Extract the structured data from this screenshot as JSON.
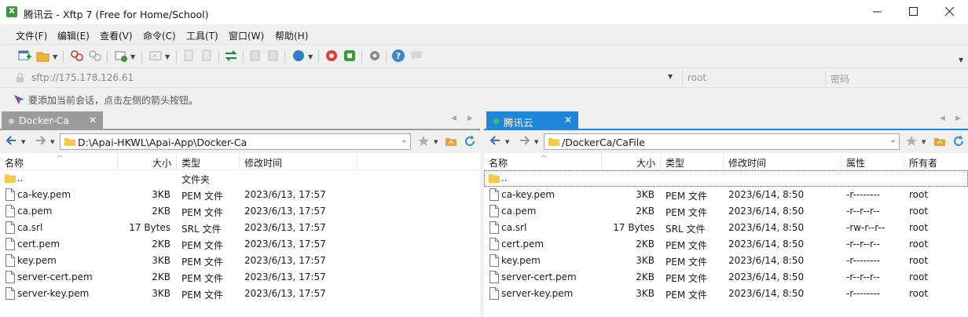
{
  "window": {
    "title": "腾讯云 - Xftp 7 (Free for Home/School)",
    "controls": [
      "minimize",
      "maximize",
      "close"
    ]
  },
  "menu": [
    "文件(F)",
    "编辑(E)",
    "查看(V)",
    "命令(C)",
    "工具(T)",
    "窗口(W)",
    "帮助(H)"
  ],
  "address": {
    "url": "sftp://175.178.126.61",
    "user_placeholder": "root",
    "password_placeholder": "密码"
  },
  "hint": "要添加当前会话，点击左侧的箭头按钮。",
  "left": {
    "tab": "Docker-Ca",
    "path": "D:\\Apai-HKWL\\Apai-App\\Docker-Ca",
    "columns": [
      "名称",
      "大小",
      "类型",
      "修改时间"
    ],
    "rows": [
      {
        "name": "..",
        "size": "",
        "type": "文件夹",
        "modified": "",
        "folder": true
      },
      {
        "name": "ca-key.pem",
        "size": "3KB",
        "type": "PEM 文件",
        "modified": "2023/6/13, 17:57"
      },
      {
        "name": "ca.pem",
        "size": "2KB",
        "type": "PEM 文件",
        "modified": "2023/6/13, 17:57"
      },
      {
        "name": "ca.srl",
        "size": "17 Bytes",
        "type": "SRL 文件",
        "modified": "2023/6/13, 17:57"
      },
      {
        "name": "cert.pem",
        "size": "2KB",
        "type": "PEM 文件",
        "modified": "2023/6/13, 17:57"
      },
      {
        "name": "key.pem",
        "size": "3KB",
        "type": "PEM 文件",
        "modified": "2023/6/13, 17:57"
      },
      {
        "name": "server-cert.pem",
        "size": "2KB",
        "type": "PEM 文件",
        "modified": "2023/6/13, 17:57"
      },
      {
        "name": "server-key.pem",
        "size": "3KB",
        "type": "PEM 文件",
        "modified": "2023/6/13, 17:57"
      }
    ]
  },
  "right": {
    "tab": "腾讯云",
    "path": "/DockerCa/CaFile",
    "columns": [
      "名称",
      "大小",
      "类型",
      "修改时间",
      "属性",
      "所有者"
    ],
    "rows": [
      {
        "name": "..",
        "size": "",
        "type": "",
        "modified": "",
        "attr": "",
        "owner": "",
        "folder": true
      },
      {
        "name": "ca-key.pem",
        "size": "3KB",
        "type": "PEM 文件",
        "modified": "2023/6/14, 8:50",
        "attr": "-r--------",
        "owner": "root"
      },
      {
        "name": "ca.pem",
        "size": "2KB",
        "type": "PEM 文件",
        "modified": "2023/6/14, 8:50",
        "attr": "-r--r--r--",
        "owner": "root"
      },
      {
        "name": "ca.srl",
        "size": "17 Bytes",
        "type": "SRL 文件",
        "modified": "2023/6/14, 8:50",
        "attr": "-rw-r--r--",
        "owner": "root"
      },
      {
        "name": "cert.pem",
        "size": "2KB",
        "type": "PEM 文件",
        "modified": "2023/6/14, 8:50",
        "attr": "-r--r--r--",
        "owner": "root"
      },
      {
        "name": "key.pem",
        "size": "3KB",
        "type": "PEM 文件",
        "modified": "2023/6/14, 8:50",
        "attr": "-r--------",
        "owner": "root"
      },
      {
        "name": "server-cert.pem",
        "size": "2KB",
        "type": "PEM 文件",
        "modified": "2023/6/14, 8:50",
        "attr": "-r--r--r--",
        "owner": "root"
      },
      {
        "name": "server-key.pem",
        "size": "3KB",
        "type": "PEM 文件",
        "modified": "2023/6/14, 8:50",
        "attr": "-r--------",
        "owner": "root"
      }
    ]
  },
  "colors": {
    "active_tab": "#1e86dc",
    "inactive_tab": "#9b9b9b",
    "connected_dot": "#2ecc40",
    "folder": "#f6c94a"
  }
}
